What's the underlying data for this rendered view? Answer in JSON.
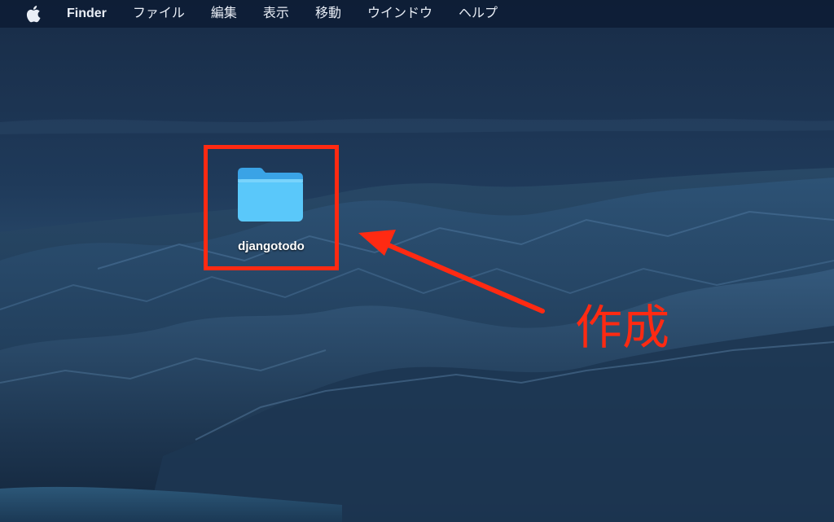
{
  "menubar": {
    "apple_icon": "apple-icon",
    "app_name": "Finder",
    "items": [
      "ファイル",
      "編集",
      "表示",
      "移動",
      "ウインドウ",
      "ヘルプ"
    ]
  },
  "desktop": {
    "folder": {
      "label": "djangotodo",
      "icon": "folder-icon"
    }
  },
  "annotation": {
    "text": "作成",
    "color": "#ff2a12",
    "arrow_icon": "arrow-icon"
  },
  "colors": {
    "folder_blue": "#5ac8fa",
    "menubar_text": "#e9eef6"
  }
}
